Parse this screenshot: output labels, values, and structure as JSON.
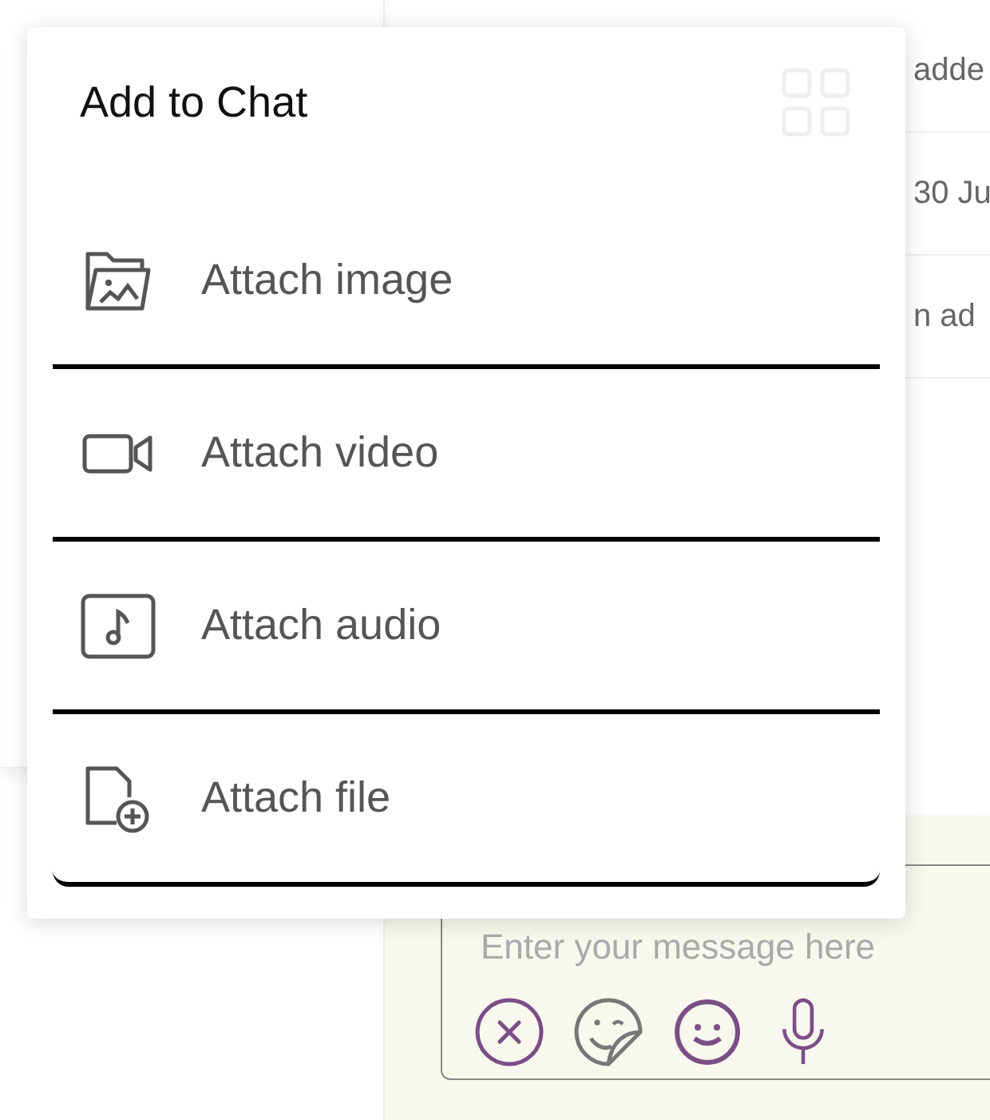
{
  "background_list": {
    "rows": [
      {
        "text": "adde"
      },
      {
        "text": "30 Ju"
      },
      {
        "text": "n ad"
      }
    ]
  },
  "composer": {
    "placeholder": "Enter your message here"
  },
  "menu": {
    "title": "Add to Chat",
    "items": [
      {
        "label": "Attach image",
        "kind": "image"
      },
      {
        "label": "Attach video",
        "kind": "video"
      },
      {
        "label": "Attach audio",
        "kind": "audio"
      },
      {
        "label": "Attach file",
        "kind": "file"
      }
    ]
  }
}
